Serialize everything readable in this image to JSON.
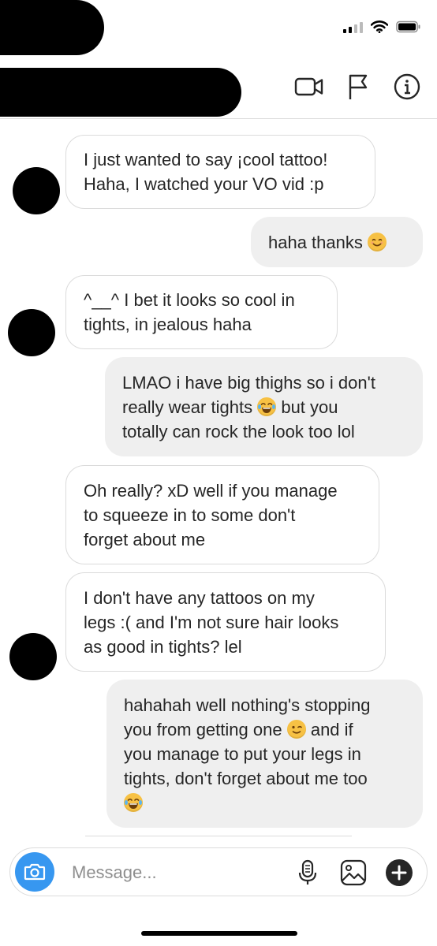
{
  "composer": {
    "placeholder": "Message..."
  },
  "messages": [
    {
      "dir": "in",
      "lines": [
        "I just wanted to say ¡cool tattoo!",
        "Haha, I watched your VO vid :p"
      ]
    },
    {
      "dir": "out",
      "lines": [
        "haha thanks"
      ],
      "emoji": "smiling-face-emoji"
    },
    {
      "dir": "in",
      "lines": [
        "^__^ I bet it looks so cool in",
        "tights, in jealous haha"
      ]
    },
    {
      "dir": "out",
      "lines": [
        "LMAO i have big thighs so i don't",
        "really wear tights",
        "but you",
        "totally can rock the look too lol"
      ],
      "emoji": "tears-of-joy-emoji"
    },
    {
      "dir": "in",
      "lines": [
        "Oh really? xD well if you manage",
        "to squeeze in to some don't",
        "forget about me"
      ]
    },
    {
      "dir": "in",
      "lines": [
        "I don't have any tattoos on my",
        "legs :( and I'm not sure hair looks",
        "as good in tights? lel"
      ]
    },
    {
      "dir": "out",
      "lines": [
        "hahahah well nothing's stopping",
        "you from getting one",
        "and if",
        "you manage to put your legs in",
        "tights, don't forget about me too"
      ],
      "emoji": [
        "winking-face-emoji",
        "tears-of-joy-emoji"
      ]
    }
  ],
  "colors": {
    "accent": "#3797f0",
    "incoming_border": "#dbdbdb",
    "outgoing_bg": "#efefef",
    "text": "#262626",
    "placeholder": "#8e8e8e",
    "emoji_yellow": "#f7c144"
  },
  "icons": [
    "video-call-icon",
    "flag-icon",
    "info-icon",
    "camera-icon",
    "microphone-icon",
    "gallery-icon",
    "plus-icon"
  ]
}
